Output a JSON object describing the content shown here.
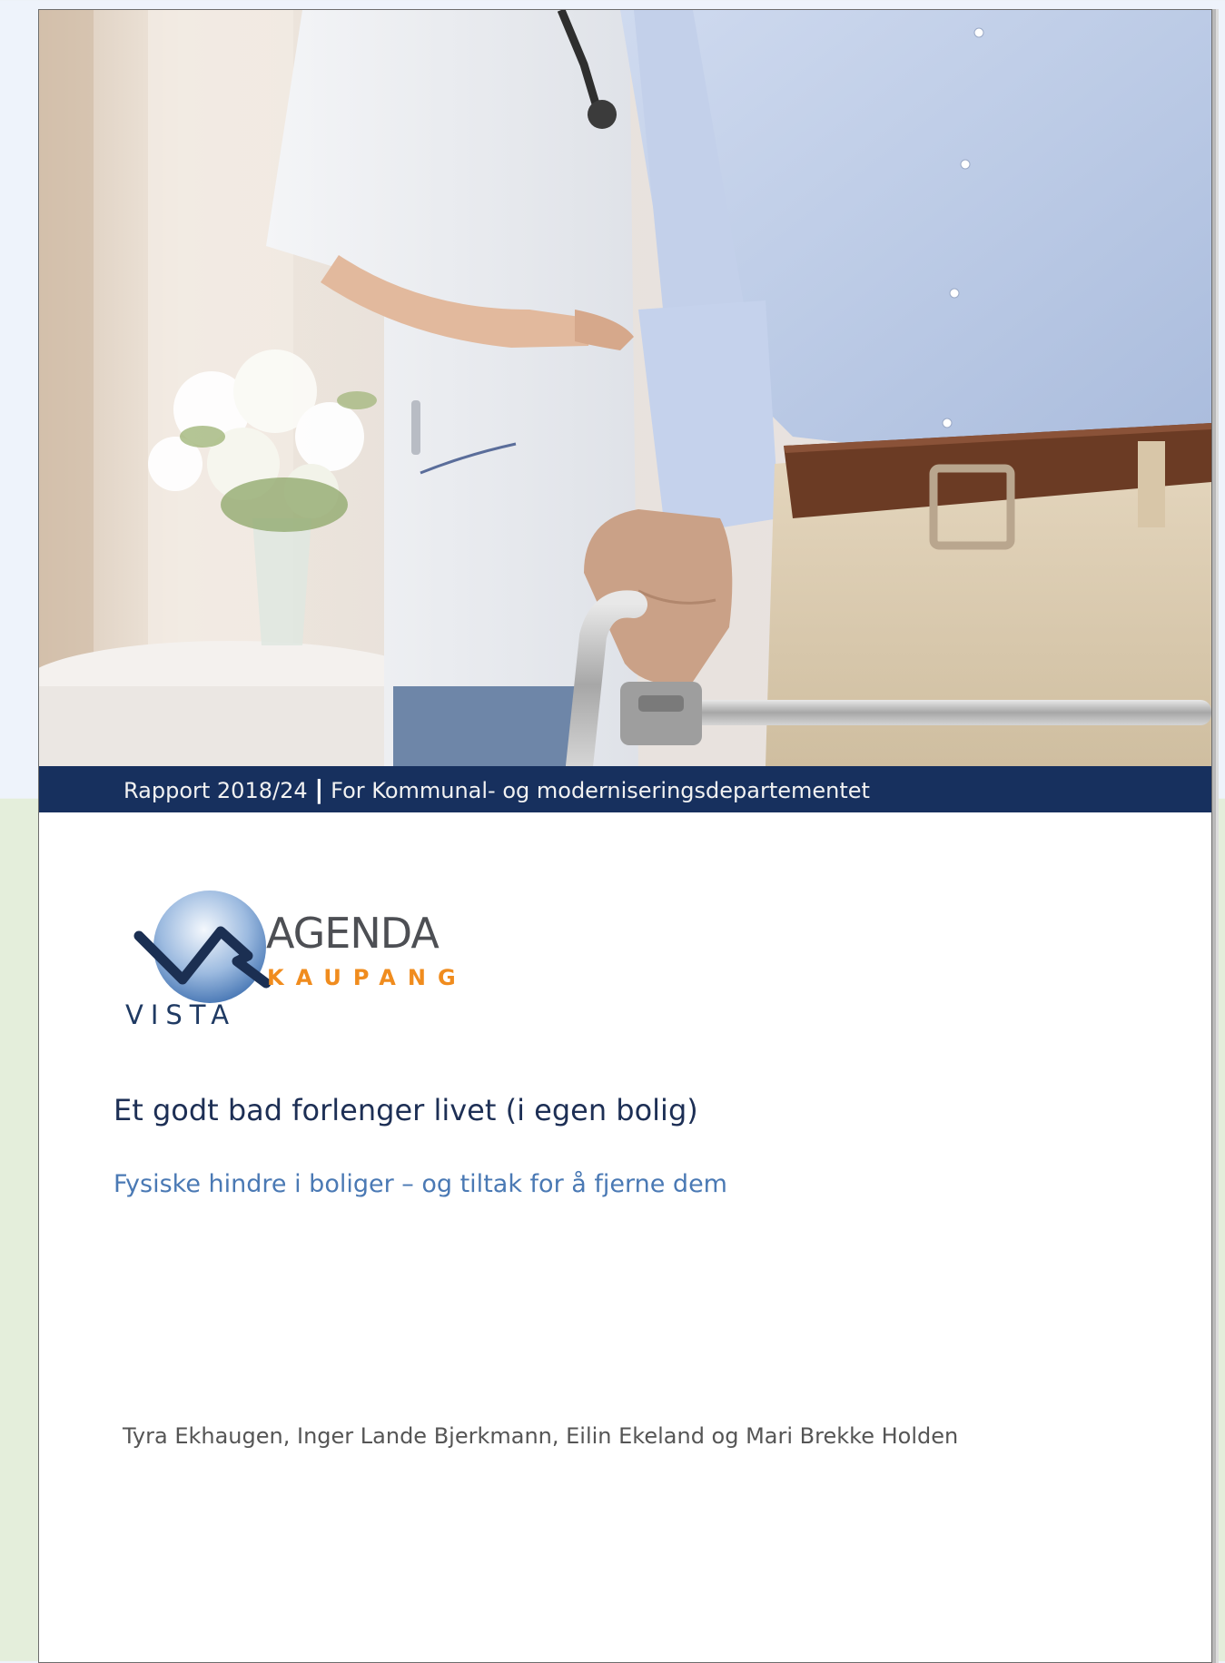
{
  "banner": {
    "report": "Rapport 2018/24",
    "separator": "|",
    "client": "For Kommunal- og moderniseringsdepartementet"
  },
  "logos": {
    "vista": "VISTA",
    "agenda": "AGENDA",
    "kaupang": "KAUPANG",
    "colors": {
      "navy": "#1f3a63",
      "orange": "#f08c1e",
      "gray": "#4d4f54"
    }
  },
  "title": "Et godt bad forlenger livet (i egen bolig)",
  "subtitle": "Fysiske hindre i boliger – og tiltak for å fjerne dem",
  "authors": "Tyra Ekhaugen, Inger Lande Bjerkmann, Eilin Ekeland og Mari Brekke Holden",
  "colors": {
    "banner": "#17305e",
    "title": "#1d2f55",
    "subtitle": "#4a79b4"
  }
}
